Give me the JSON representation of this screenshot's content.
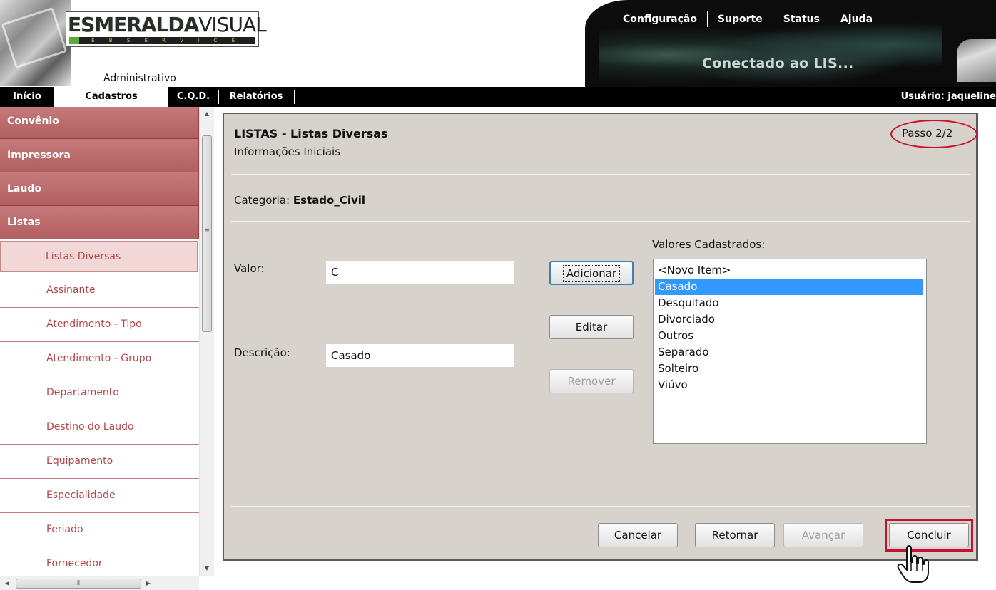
{
  "header": {
    "logo_brand_part1": "ESMERALDA",
    "logo_brand_part2": "VISUAL",
    "logo_strip_text": "W E B S E R V I C E",
    "area_label": "Administrativo",
    "top_links": [
      "Configuração",
      "Suporte",
      "Status",
      "Ajuda"
    ],
    "status_text": "Conectado ao LIS..."
  },
  "menubar": {
    "items": [
      "Início",
      "Cadastros",
      "C.Q.D.",
      "Relatórios"
    ],
    "active_item": "Cadastros",
    "user_label": "Usuário: jaqueline"
  },
  "sidebar": {
    "main_items": [
      "Convênio",
      "Impressora",
      "Laudo",
      "Listas"
    ],
    "sub_items": [
      "Listas Diversas",
      "Assinante",
      "Atendimento - Tipo",
      "Atendimento - Grupo",
      "Departamento",
      "Destino do Laudo",
      "Equipamento",
      "Especialidade",
      "Feriado",
      "Fornecedor"
    ],
    "active_sub_item": "Listas Diversas",
    "colors": {
      "main_bg": "#b9696a",
      "sub_text": "#b3474a",
      "active_bg": "#f1d7d5"
    }
  },
  "dialog": {
    "title": "LISTAS - Listas Diversas",
    "subtitle": "Informações Iniciais",
    "step": "Passo 2/2",
    "category_label": "Categoria:",
    "category_value": "Estado_Civil",
    "valor_label": "Valor:",
    "valor_value": "C",
    "descricao_label": "Descrição:",
    "descricao_value": "Casado",
    "buttons": {
      "add": "Adicionar",
      "edit": "Editar",
      "remove": "Remover",
      "cancel": "Cancelar",
      "back": "Retornar",
      "next": "Avançar",
      "finish": "Concluir"
    },
    "list_label": "Valores Cadastrados:",
    "list_items": [
      "<Novo Item>",
      "Casado",
      "Desquitado",
      "Divorciado",
      "Outros",
      "Separado",
      "Solteiro",
      "Viúvo"
    ],
    "selected_item": "Casado",
    "colors": {
      "panel_bg": "#d7d3cc",
      "highlight": "#c8102e",
      "selection": "#3399ff"
    }
  },
  "icons": {
    "scroll_up": "scroll-up-arrow-icon",
    "scroll_down": "scroll-down-arrow-icon",
    "scroll_left": "scroll-left-arrow-icon",
    "scroll_right": "scroll-right-arrow-icon",
    "cursor": "hand-pointer-icon"
  }
}
